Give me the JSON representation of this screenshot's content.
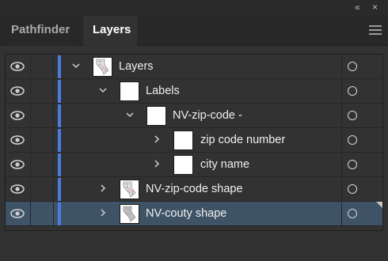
{
  "window": {
    "collapse_glyph": "«",
    "close_glyph": "×"
  },
  "tabs": [
    {
      "label": "Pathfinder",
      "active": false
    },
    {
      "label": "Layers",
      "active": true
    }
  ],
  "colors": {
    "layer_color": "#4a7be0",
    "selected_row_bg": "#3e5366",
    "panel_bg": "#323232"
  },
  "layers": [
    {
      "label": "Layers",
      "icon": "map-thumbnail",
      "expanded": true,
      "selected": false
    },
    {
      "label": "Labels",
      "icon": "blank-thumbnail",
      "expanded": true,
      "selected": false
    },
    {
      "label": "NV-zip-code -",
      "icon": "blank-thumbnail",
      "expanded": true,
      "selected": false
    },
    {
      "label": "zip code number",
      "icon": "blank-thumbnail",
      "expanded": false,
      "selected": false
    },
    {
      "label": "city name",
      "icon": "blank-thumbnail",
      "expanded": false,
      "selected": false
    },
    {
      "label": "NV-zip-code shape",
      "icon": "map-thumbnail",
      "expanded": false,
      "selected": false
    },
    {
      "label": "NV-couty shape",
      "icon": "gray-map-thumbnail",
      "expanded": false,
      "selected": true
    }
  ]
}
